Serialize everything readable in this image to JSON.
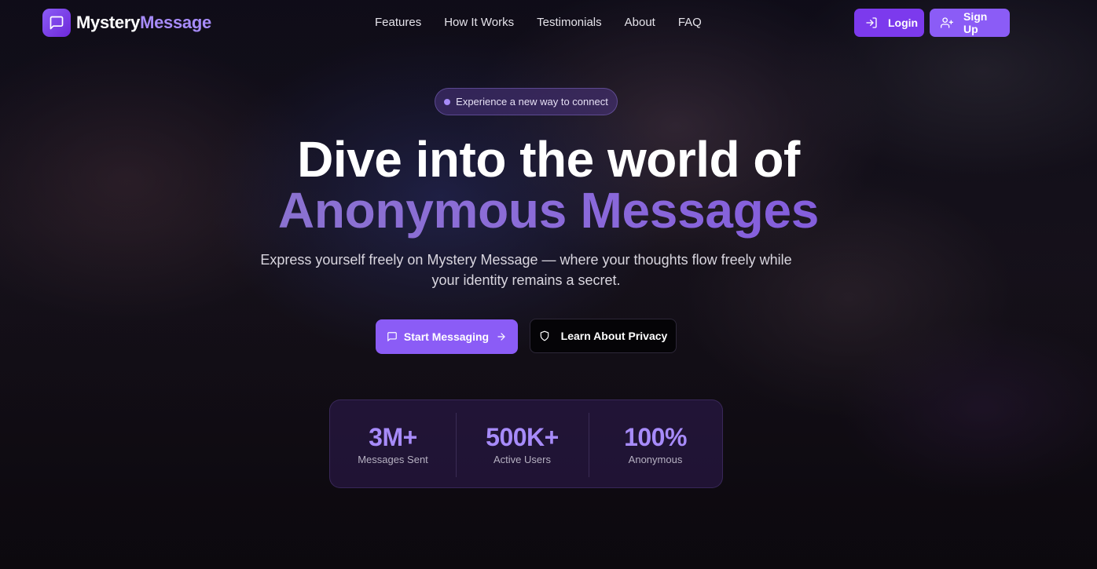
{
  "brand": {
    "name_part1": "Mystery",
    "name_part2": "Message",
    "icon": "message-square-icon"
  },
  "nav": {
    "links": [
      "Features",
      "How It Works",
      "Testimonials",
      "About",
      "FAQ"
    ],
    "login_label": "Login",
    "signup_label": "Sign Up"
  },
  "hero": {
    "pill_text": "Experience a new way to connect",
    "title_line1": "Dive into the world of",
    "title_line2": "Anonymous Messages",
    "subtitle": "Express yourself freely on Mystery Message — where your thoughts flow freely while your identity remains a secret.",
    "primary_cta": "Start Messaging",
    "secondary_cta": "Learn About Privacy"
  },
  "stats": [
    {
      "value": "3M+",
      "label": "Messages Sent"
    },
    {
      "value": "500K+",
      "label": "Active Users"
    },
    {
      "value": "100%",
      "label": "Anonymous"
    }
  ],
  "colors": {
    "accent": "#8b5cf6",
    "accent_dark": "#7c3aed",
    "accent_light": "#a78bfa"
  }
}
